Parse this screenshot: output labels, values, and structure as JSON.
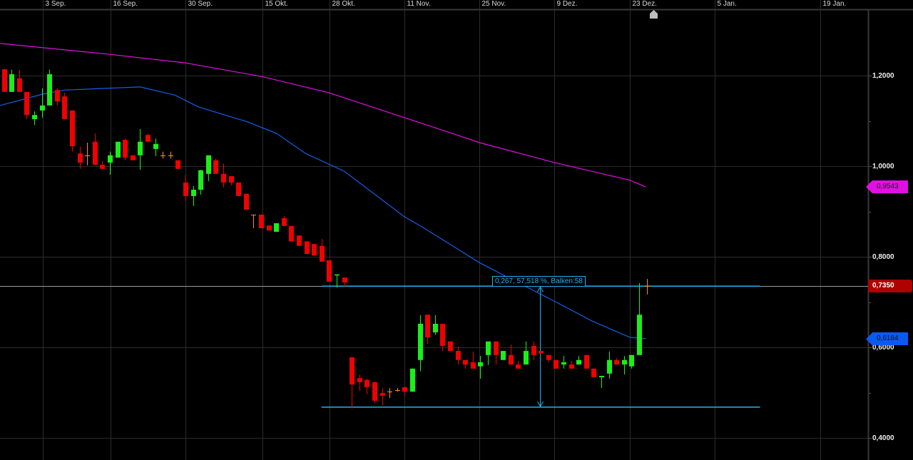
{
  "chart_data": {
    "type": "candlestick",
    "title": "",
    "x_ticks": [
      {
        "label": "3 Sep.",
        "bar": 5.1
      },
      {
        "label": "16 Sep.",
        "bar": 14.1
      },
      {
        "label": "30 Sep.",
        "bar": 24
      },
      {
        "label": "15 Okt.",
        "bar": 34.2
      },
      {
        "label": "28 Okt.",
        "bar": 43.1
      },
      {
        "label": "11 Nov.",
        "bar": 53
      },
      {
        "label": "25 Nov.",
        "bar": 62.9
      },
      {
        "label": "9 Dez.",
        "bar": 72.8
      },
      {
        "label": "23 Dez.",
        "bar": 82.8
      },
      {
        "label": "5 Jan.",
        "bar": 94
      },
      {
        "label": "19 Jan.",
        "bar": 108
      }
    ],
    "y_ticks": [
      {
        "label": "1,2000",
        "value": 1.2
      },
      {
        "label": "1,0000",
        "value": 1.0
      },
      {
        "label": "0,8000",
        "value": 0.8
      },
      {
        "label": "0,6000",
        "value": 0.6
      },
      {
        "label": "0,4000",
        "value": 0.4
      }
    ],
    "ylim": [
      0.353,
      1.367
    ],
    "grid": true,
    "colors": {
      "up": "#19f019",
      "down": "#f00000",
      "doji": "#f0961e",
      "ma_fast": "#1060e8",
      "ma_slow": "#e010e0",
      "measure": "#1fb4f0",
      "last": "#b00000"
    },
    "ohlc": [
      [
        1.214,
        1.214,
        1.164,
        1.164
      ],
      [
        1.164,
        1.213,
        1.164,
        1.203
      ],
      [
        1.194,
        1.213,
        1.164,
        1.164
      ],
      [
        1.164,
        1.164,
        1.104,
        1.113
      ],
      [
        1.104,
        1.121,
        1.091,
        1.113
      ],
      [
        1.123,
        1.172,
        1.107,
        1.134
      ],
      [
        1.134,
        1.213,
        1.134,
        1.203
      ],
      [
        1.168,
        1.172,
        1.134,
        1.143
      ],
      [
        1.154,
        1.162,
        1.104,
        1.104
      ],
      [
        1.123,
        1.123,
        1.033,
        1.044
      ],
      [
        1.028,
        1.043,
        0.994,
        1.008
      ],
      [
        1.024,
        1.052,
        1.002,
        1.024
      ],
      [
        1.054,
        1.072,
        1.003,
        1.003
      ],
      [
        1.003,
        1.011,
        0.994,
        0.994
      ],
      [
        1.008,
        1.032,
        0.981,
        1.024
      ],
      [
        1.019,
        1.054,
        1.019,
        1.054
      ],
      [
        1.058,
        1.061,
        1.013,
        1.019
      ],
      [
        1.024,
        1.024,
        1.013,
        1.013
      ],
      [
        1.024,
        1.082,
        0.992,
        1.054
      ],
      [
        1.069,
        1.072,
        1.054,
        1.054
      ],
      [
        1.038,
        1.061,
        1.022,
        1.049
      ],
      [
        1.024,
        1.032,
        1.017,
        1.024
      ],
      [
        1.024,
        1.032,
        1.017,
        1.024
      ],
      [
        1.013,
        1.013,
        0.994,
        0.994
      ],
      [
        0.964,
        0.981,
        0.923,
        0.934
      ],
      [
        0.934,
        0.956,
        0.912,
        0.948
      ],
      [
        0.948,
        0.992,
        0.937,
        0.991
      ],
      [
        0.983,
        1.024,
        0.967,
        1.024
      ],
      [
        1.013,
        1.017,
        0.983,
        0.983
      ],
      [
        0.983,
        1.006,
        0.953,
        0.964
      ],
      [
        0.978,
        0.978,
        0.957,
        0.964
      ],
      [
        0.964,
        0.964,
        0.934,
        0.934
      ],
      [
        0.939,
        0.939,
        0.904,
        0.904
      ],
      [
        0.893,
        0.893,
        0.863,
        0.893
      ],
      [
        0.893,
        0.893,
        0.863,
        0.863
      ],
      [
        0.869,
        0.869,
        0.858,
        0.858
      ],
      [
        0.855,
        0.874,
        0.855,
        0.874
      ],
      [
        0.885,
        0.89,
        0.868,
        0.868
      ],
      [
        0.868,
        0.868,
        0.834,
        0.834
      ],
      [
        0.847,
        0.847,
        0.824,
        0.824
      ],
      [
        0.834,
        0.834,
        0.806,
        0.806
      ],
      [
        0.828,
        0.828,
        0.803,
        0.803
      ],
      [
        0.824,
        0.839,
        0.789,
        0.789
      ],
      [
        0.792,
        0.792,
        0.745,
        0.745
      ],
      [
        0.759,
        0.761,
        0.732,
        0.761
      ],
      [
        0.754,
        0.754,
        0.732,
        0.743
      ],
      [
        0.578,
        0.578,
        0.465,
        0.518
      ],
      [
        0.532,
        0.54,
        0.504,
        0.523
      ],
      [
        0.528,
        0.531,
        0.496,
        0.512
      ],
      [
        0.523,
        0.523,
        0.477,
        0.482
      ],
      [
        0.499,
        0.51,
        0.472,
        0.493
      ],
      [
        0.502,
        0.51,
        0.488,
        0.502
      ],
      [
        0.506,
        0.51,
        0.502,
        0.506
      ],
      [
        0.512,
        0.512,
        0.493,
        0.502
      ],
      [
        0.502,
        0.553,
        0.502,
        0.553
      ],
      [
        0.572,
        0.671,
        0.547,
        0.652
      ],
      [
        0.672,
        0.672,
        0.608,
        0.622
      ],
      [
        0.633,
        0.671,
        0.628,
        0.652
      ],
      [
        0.652,
        0.652,
        0.592,
        0.603
      ],
      [
        0.613,
        0.613,
        0.592,
        0.592
      ],
      [
        0.592,
        0.602,
        0.562,
        0.572
      ],
      [
        0.572,
        0.572,
        0.553,
        0.562
      ],
      [
        0.567,
        0.591,
        0.553,
        0.553
      ],
      [
        0.558,
        0.581,
        0.531,
        0.567
      ],
      [
        0.583,
        0.613,
        0.561,
        0.613
      ],
      [
        0.613,
        0.613,
        0.562,
        0.583
      ],
      [
        0.572,
        0.592,
        0.572,
        0.592
      ],
      [
        0.583,
        0.606,
        0.562,
        0.562
      ],
      [
        0.562,
        0.57,
        0.553,
        0.553
      ],
      [
        0.562,
        0.613,
        0.562,
        0.592
      ],
      [
        0.603,
        0.613,
        0.572,
        0.583
      ],
      [
        0.592,
        0.592,
        0.587,
        0.587
      ],
      [
        0.583,
        0.583,
        0.567,
        0.572
      ],
      [
        0.572,
        0.572,
        0.553,
        0.553
      ],
      [
        0.562,
        0.581,
        0.553,
        0.567
      ],
      [
        0.562,
        0.57,
        0.553,
        0.553
      ],
      [
        0.562,
        0.581,
        0.562,
        0.572
      ],
      [
        0.583,
        0.583,
        0.553,
        0.553
      ],
      [
        0.553,
        0.553,
        0.534,
        0.534
      ],
      [
        0.534,
        0.537,
        0.51,
        0.537
      ],
      [
        0.542,
        0.591,
        0.531,
        0.572
      ],
      [
        0.572,
        0.576,
        0.562,
        0.562
      ],
      [
        0.562,
        0.581,
        0.54,
        0.572
      ],
      [
        0.558,
        0.583,
        0.553,
        0.583
      ],
      [
        0.583,
        0.742,
        0.583,
        0.672
      ],
      [
        0.735,
        0.751,
        0.717,
        0.735
      ]
    ],
    "ma_fast": [
      [
        -0.5,
        1.134
      ],
      [
        5.1,
        1.159
      ],
      [
        8,
        1.168
      ],
      [
        18,
        1.175
      ],
      [
        22.6,
        1.157
      ],
      [
        25.7,
        1.131
      ],
      [
        32.2,
        1.098
      ],
      [
        36.1,
        1.072
      ],
      [
        39.9,
        1.028
      ],
      [
        45,
        0.989
      ],
      [
        53,
        0.888
      ],
      [
        55.3,
        0.866
      ],
      [
        62.9,
        0.787
      ],
      [
        67.4,
        0.748
      ],
      [
        72.9,
        0.701
      ],
      [
        77.8,
        0.658
      ],
      [
        82.8,
        0.622
      ],
      [
        84.9,
        0.619
      ]
    ],
    "ma_slow": [
      [
        -0.5,
        1.271
      ],
      [
        14,
        1.247
      ],
      [
        24,
        1.228
      ],
      [
        34.1,
        1.198
      ],
      [
        43,
        1.162
      ],
      [
        53,
        1.107
      ],
      [
        59.9,
        1.069
      ],
      [
        62.9,
        1.052
      ],
      [
        72.8,
        1.008
      ],
      [
        82.8,
        0.969
      ],
      [
        84.9,
        0.954
      ]
    ],
    "measure": {
      "top": 0.735,
      "bottom": 0.468,
      "from_bar": 42,
      "to_bar": 100,
      "arrow_bar": 70.9,
      "label": "0,267, 57,518 %, Balken:58"
    },
    "last_price": {
      "value": 0.735,
      "label": "0,7350"
    },
    "ma_slow_tag": {
      "value": 0.9543,
      "label": "0,9543"
    },
    "ma_fast_tag": {
      "value": 0.6184,
      "label": "0,6184"
    }
  }
}
